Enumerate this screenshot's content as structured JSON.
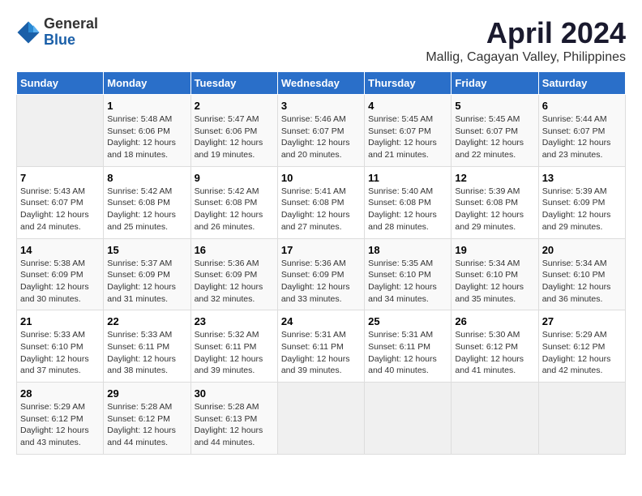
{
  "logo": {
    "general": "General",
    "blue": "Blue"
  },
  "title": "April 2024",
  "location": "Mallig, Cagayan Valley, Philippines",
  "days_of_week": [
    "Sunday",
    "Monday",
    "Tuesday",
    "Wednesday",
    "Thursday",
    "Friday",
    "Saturday"
  ],
  "weeks": [
    [
      {
        "day": "",
        "info": ""
      },
      {
        "day": "1",
        "info": "Sunrise: 5:48 AM\nSunset: 6:06 PM\nDaylight: 12 hours\nand 18 minutes."
      },
      {
        "day": "2",
        "info": "Sunrise: 5:47 AM\nSunset: 6:06 PM\nDaylight: 12 hours\nand 19 minutes."
      },
      {
        "day": "3",
        "info": "Sunrise: 5:46 AM\nSunset: 6:07 PM\nDaylight: 12 hours\nand 20 minutes."
      },
      {
        "day": "4",
        "info": "Sunrise: 5:45 AM\nSunset: 6:07 PM\nDaylight: 12 hours\nand 21 minutes."
      },
      {
        "day": "5",
        "info": "Sunrise: 5:45 AM\nSunset: 6:07 PM\nDaylight: 12 hours\nand 22 minutes."
      },
      {
        "day": "6",
        "info": "Sunrise: 5:44 AM\nSunset: 6:07 PM\nDaylight: 12 hours\nand 23 minutes."
      }
    ],
    [
      {
        "day": "7",
        "info": "Sunrise: 5:43 AM\nSunset: 6:07 PM\nDaylight: 12 hours\nand 24 minutes."
      },
      {
        "day": "8",
        "info": "Sunrise: 5:42 AM\nSunset: 6:08 PM\nDaylight: 12 hours\nand 25 minutes."
      },
      {
        "day": "9",
        "info": "Sunrise: 5:42 AM\nSunset: 6:08 PM\nDaylight: 12 hours\nand 26 minutes."
      },
      {
        "day": "10",
        "info": "Sunrise: 5:41 AM\nSunset: 6:08 PM\nDaylight: 12 hours\nand 27 minutes."
      },
      {
        "day": "11",
        "info": "Sunrise: 5:40 AM\nSunset: 6:08 PM\nDaylight: 12 hours\nand 28 minutes."
      },
      {
        "day": "12",
        "info": "Sunrise: 5:39 AM\nSunset: 6:08 PM\nDaylight: 12 hours\nand 29 minutes."
      },
      {
        "day": "13",
        "info": "Sunrise: 5:39 AM\nSunset: 6:09 PM\nDaylight: 12 hours\nand 29 minutes."
      }
    ],
    [
      {
        "day": "14",
        "info": "Sunrise: 5:38 AM\nSunset: 6:09 PM\nDaylight: 12 hours\nand 30 minutes."
      },
      {
        "day": "15",
        "info": "Sunrise: 5:37 AM\nSunset: 6:09 PM\nDaylight: 12 hours\nand 31 minutes."
      },
      {
        "day": "16",
        "info": "Sunrise: 5:36 AM\nSunset: 6:09 PM\nDaylight: 12 hours\nand 32 minutes."
      },
      {
        "day": "17",
        "info": "Sunrise: 5:36 AM\nSunset: 6:09 PM\nDaylight: 12 hours\nand 33 minutes."
      },
      {
        "day": "18",
        "info": "Sunrise: 5:35 AM\nSunset: 6:10 PM\nDaylight: 12 hours\nand 34 minutes."
      },
      {
        "day": "19",
        "info": "Sunrise: 5:34 AM\nSunset: 6:10 PM\nDaylight: 12 hours\nand 35 minutes."
      },
      {
        "day": "20",
        "info": "Sunrise: 5:34 AM\nSunset: 6:10 PM\nDaylight: 12 hours\nand 36 minutes."
      }
    ],
    [
      {
        "day": "21",
        "info": "Sunrise: 5:33 AM\nSunset: 6:10 PM\nDaylight: 12 hours\nand 37 minutes."
      },
      {
        "day": "22",
        "info": "Sunrise: 5:33 AM\nSunset: 6:11 PM\nDaylight: 12 hours\nand 38 minutes."
      },
      {
        "day": "23",
        "info": "Sunrise: 5:32 AM\nSunset: 6:11 PM\nDaylight: 12 hours\nand 39 minutes."
      },
      {
        "day": "24",
        "info": "Sunrise: 5:31 AM\nSunset: 6:11 PM\nDaylight: 12 hours\nand 39 minutes."
      },
      {
        "day": "25",
        "info": "Sunrise: 5:31 AM\nSunset: 6:11 PM\nDaylight: 12 hours\nand 40 minutes."
      },
      {
        "day": "26",
        "info": "Sunrise: 5:30 AM\nSunset: 6:12 PM\nDaylight: 12 hours\nand 41 minutes."
      },
      {
        "day": "27",
        "info": "Sunrise: 5:29 AM\nSunset: 6:12 PM\nDaylight: 12 hours\nand 42 minutes."
      }
    ],
    [
      {
        "day": "28",
        "info": "Sunrise: 5:29 AM\nSunset: 6:12 PM\nDaylight: 12 hours\nand 43 minutes."
      },
      {
        "day": "29",
        "info": "Sunrise: 5:28 AM\nSunset: 6:12 PM\nDaylight: 12 hours\nand 44 minutes."
      },
      {
        "day": "30",
        "info": "Sunrise: 5:28 AM\nSunset: 6:13 PM\nDaylight: 12 hours\nand 44 minutes."
      },
      {
        "day": "",
        "info": ""
      },
      {
        "day": "",
        "info": ""
      },
      {
        "day": "",
        "info": ""
      },
      {
        "day": "",
        "info": ""
      }
    ]
  ]
}
